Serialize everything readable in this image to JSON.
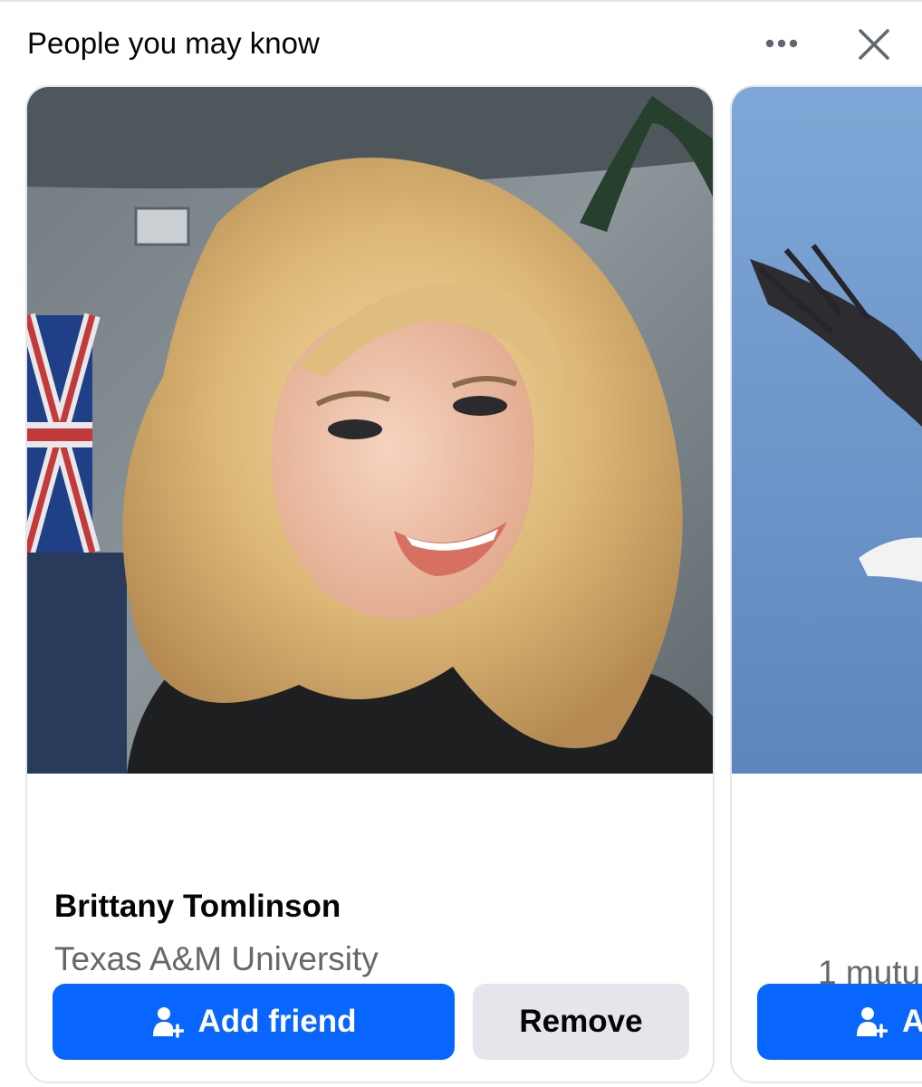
{
  "header": {
    "title": "People you may know",
    "more_icon": "more-horizontal-icon",
    "close_icon": "close-icon"
  },
  "cards": [
    {
      "name": "Brittany Tomlinson",
      "subtitle": "Texas A&M University",
      "add_friend_label": "Add friend",
      "remove_label": "Remove",
      "add_friend_icon": "add-person-icon"
    },
    {
      "subtitle": "1 mutu",
      "add_friend_label": "A",
      "add_friend_icon": "add-person-icon"
    }
  ],
  "colors": {
    "primary_button": "#0866ff",
    "secondary_button": "#e4e6eb",
    "secondary_text": "#65676b",
    "primary_text": "#050505"
  }
}
